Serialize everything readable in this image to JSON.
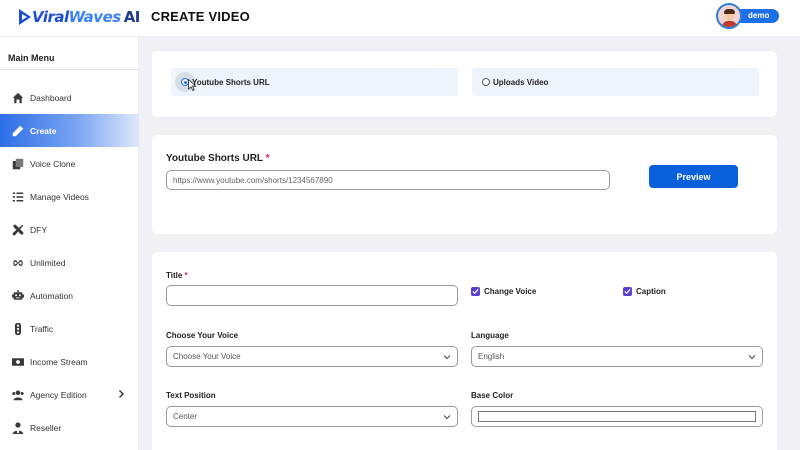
{
  "app": {
    "logo_part1": "Viral",
    "logo_part2": "Waves",
    "logo_part3": "AI",
    "page_title": "CREATE VIDEO",
    "user_name": "demo"
  },
  "sidebar": {
    "heading": "Main Menu",
    "items": [
      {
        "label": "Dashboard",
        "icon": "home-icon"
      },
      {
        "label": "Create",
        "icon": "pencil-icon",
        "active": true
      },
      {
        "label": "Voice Clone",
        "icon": "copy-icon"
      },
      {
        "label": "Manage Videos",
        "icon": "list-icon"
      },
      {
        "label": "DFY",
        "icon": "tools-icon"
      },
      {
        "label": "Unlimited",
        "icon": "infinity-icon"
      },
      {
        "label": "Automation",
        "icon": "robot-icon"
      },
      {
        "label": "Traffic",
        "icon": "traffic-light-icon"
      },
      {
        "label": "Income Stream",
        "icon": "money-icon"
      },
      {
        "label": "Agency Edition",
        "icon": "users-icon",
        "has_submenu": true
      },
      {
        "label": "Reseller",
        "icon": "user-tie-icon"
      }
    ]
  },
  "source": {
    "option_shorts": "Youtube Shorts URL",
    "option_upload": "Uploads Video",
    "selected": "shorts"
  },
  "url_section": {
    "label": "Youtube Shorts URL",
    "required_mark": "*",
    "placeholder": "https://www.youtube.com/shorts/1234567890",
    "value": "",
    "preview_label": "Preview"
  },
  "form": {
    "title_label": "Title",
    "title_required": "*",
    "title_value": "",
    "change_voice_label": "Change Voice",
    "change_voice_checked": true,
    "caption_label": "Caption",
    "caption_checked": true,
    "voice_label": "Choose Your Voice",
    "voice_value": "Choose Your Voice",
    "language_label": "Language",
    "language_value": "English",
    "text_position_label": "Text Position",
    "text_position_value": "Center",
    "base_color_label": "Base Color",
    "base_color_value": "#ffffff"
  },
  "colors": {
    "accent": "#1d6fe8",
    "button": "#0a5fdb",
    "checkbox": "#5b3fd6",
    "required": "#e11d48"
  }
}
